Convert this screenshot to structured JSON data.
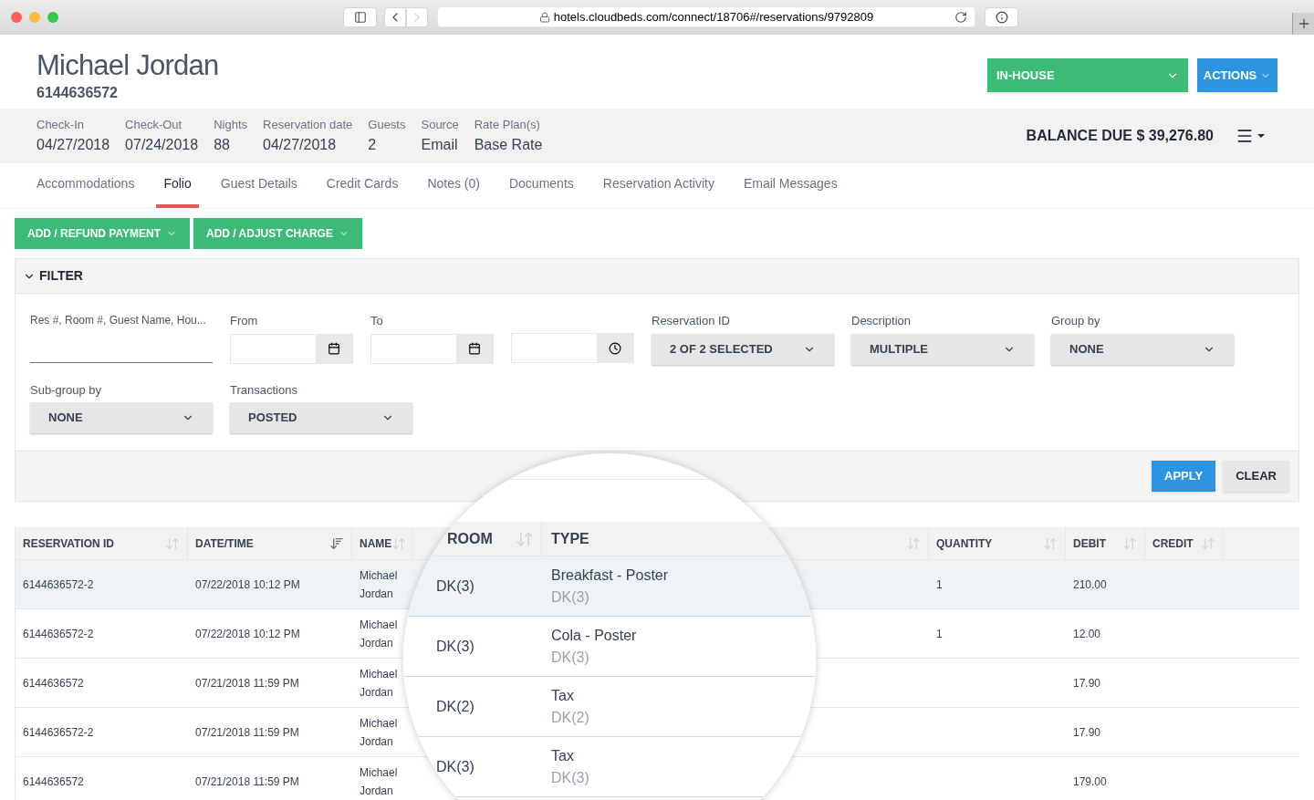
{
  "browser": {
    "url": "hotels.cloudbeds.com/connect/18706#/reservations/9792809"
  },
  "guest": {
    "name": "Michael Jordan",
    "reservation_number": "6144636572"
  },
  "status_button": "IN-HOUSE",
  "actions_button": "ACTIONS",
  "summary": [
    {
      "label": "Check-In",
      "value": "04/27/2018"
    },
    {
      "label": "Check-Out",
      "value": "07/24/2018"
    },
    {
      "label": "Nights",
      "value": "88"
    },
    {
      "label": "Reservation date",
      "value": "04/27/2018"
    },
    {
      "label": "Guests",
      "value": "2"
    },
    {
      "label": "Source",
      "value": "Email"
    },
    {
      "label": "Rate Plan(s)",
      "value": "Base Rate"
    }
  ],
  "balance": "BALANCE DUE $ 39,276.80",
  "tabs": [
    {
      "label": "Accommodations",
      "selected": false
    },
    {
      "label": "Folio",
      "selected": true
    },
    {
      "label": "Guest Details",
      "selected": false
    },
    {
      "label": "Credit Cards",
      "selected": false
    },
    {
      "label": "Notes (0)",
      "selected": false
    },
    {
      "label": "Documents",
      "selected": false
    },
    {
      "label": "Reservation Activity",
      "selected": false
    },
    {
      "label": "Email Messages",
      "selected": false
    }
  ],
  "folio_buttons": [
    "ADD / REFUND PAYMENT",
    "ADD / ADJUST CHARGE"
  ],
  "filter": {
    "title": "FILTER",
    "expanded": true,
    "search_label": "Res #, Room #, Guest Name, Hou...",
    "from_label": "From",
    "to_label": "To",
    "selects_row1": [
      {
        "label": "Reservation ID",
        "value": "2 OF 2 SELECTED"
      },
      {
        "label": "Description",
        "value": "MULTIPLE"
      },
      {
        "label": "Group by",
        "value": "NONE"
      }
    ],
    "selects_row2": [
      {
        "label": "Sub-group by",
        "value": "NONE"
      },
      {
        "label": "Transactions",
        "value": "POSTED"
      }
    ],
    "apply": "APPLY",
    "clear": "CLEAR"
  },
  "table": {
    "columns": [
      {
        "label": "RESERVATION ID",
        "sorted": false
      },
      {
        "label": "DATE/TIME",
        "sorted": true
      },
      {
        "label": "NAME",
        "sorted": false
      },
      {
        "label": "QUANTITY",
        "sorted": false
      },
      {
        "label": "DEBIT",
        "sorted": false
      },
      {
        "label": "CREDIT",
        "sorted": false
      }
    ],
    "rows": [
      {
        "reservation_id": "6144636572-2",
        "date_time": "07/22/2018 10:12 PM",
        "name": "Michael Jordan",
        "quantity": "1",
        "debit": "210.00",
        "selected": true
      },
      {
        "reservation_id": "6144636572-2",
        "date_time": "07/22/2018 10:12 PM",
        "name": "Michael Jordan",
        "quantity": "1",
        "debit": "12.00",
        "selected": false
      },
      {
        "reservation_id": "6144636572",
        "date_time": "07/21/2018 11:59 PM",
        "name": "Michael Jordan",
        "debit": "17.90",
        "selected": false
      },
      {
        "reservation_id": "6144636572-2",
        "date_time": "07/21/2018 11:59 PM",
        "name": "Michael Jordan",
        "debit": "17.90",
        "selected": false
      },
      {
        "reservation_id": "6144636572",
        "date_time": "07/21/2018 11:59 PM",
        "name": "Michael Jordan",
        "debit": "179.00",
        "selected": false
      }
    ]
  },
  "magnifier": {
    "columns": [
      "ROOM",
      "TYPE"
    ],
    "rows": [
      {
        "room": "DK(3)",
        "type": "Breakfast - Poster",
        "subtype": "DK(3)",
        "selected": true
      },
      {
        "room": "DK(3)",
        "type": "Cola - Poster",
        "subtype": "DK(3)",
        "selected": false
      },
      {
        "room": "DK(2)",
        "type": "Tax",
        "subtype": "DK(2)",
        "selected": false
      },
      {
        "room": "DK(3)",
        "type": "Tax",
        "subtype": "DK(3)",
        "selected": false
      }
    ]
  }
}
